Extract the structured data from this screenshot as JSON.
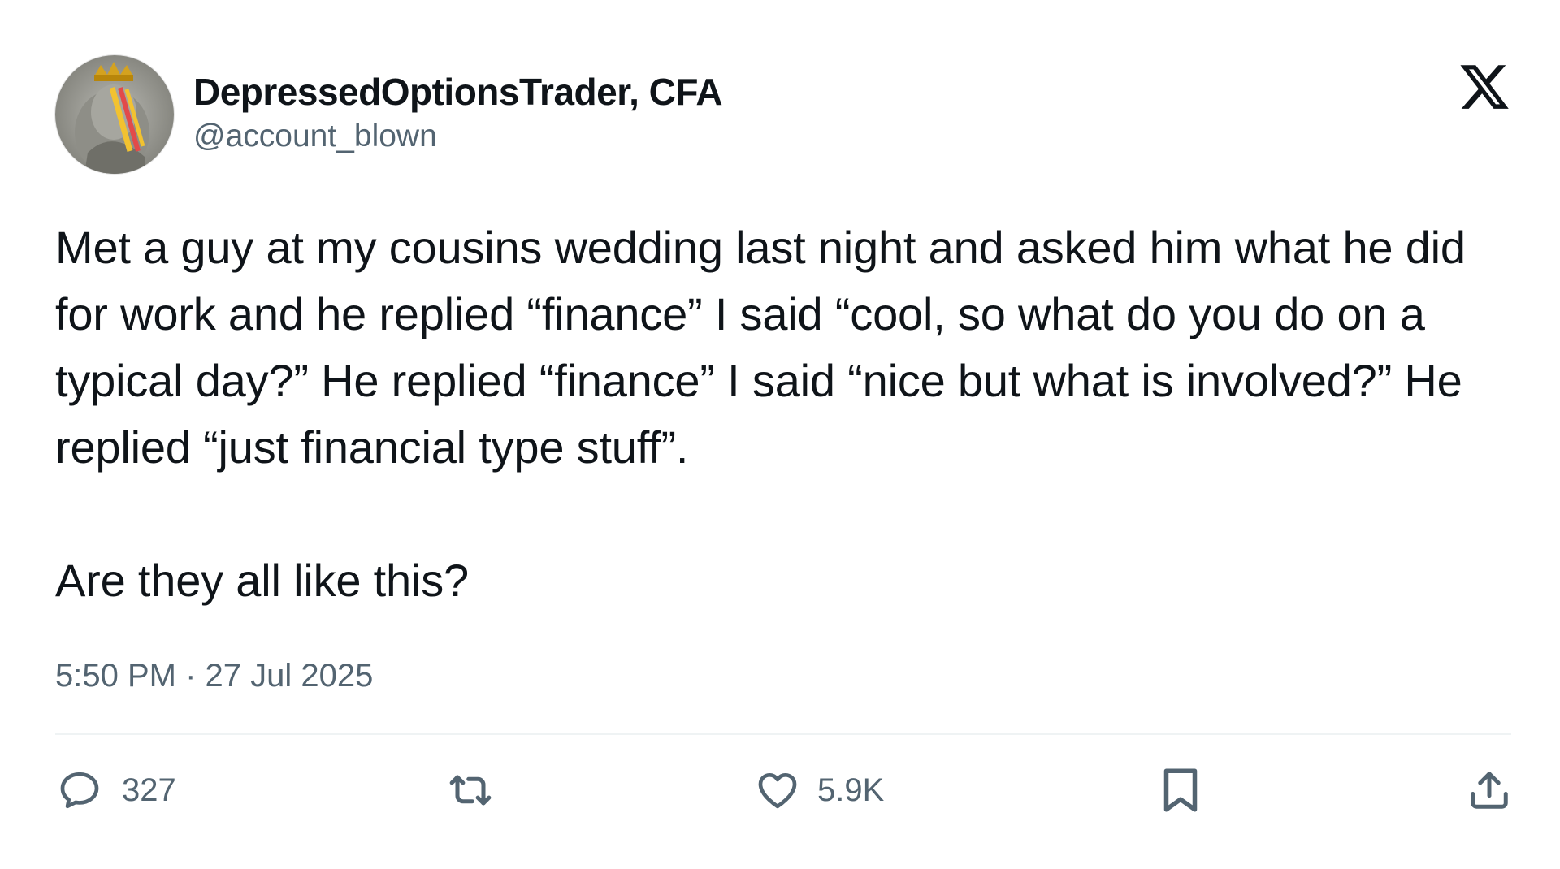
{
  "author": {
    "display_name": "DepressedOptionsTrader, CFA",
    "handle": "@account_blown",
    "avatar_icon": "avatar-photo"
  },
  "brand": {
    "logo_icon": "x-logo"
  },
  "tweet": {
    "paragraph_1": "Met a guy at my cousins wedding last night and asked him what he did for work and he replied “finance” I said “cool, so what do you do on a typical day?” He replied “finance” I said “nice but what is involved?” He replied “just financial type stuff”.",
    "paragraph_2": "Are they all like this?",
    "timestamp": "5:50 PM · 27 Jul 2025"
  },
  "actions": {
    "reply": {
      "icon": "reply-icon",
      "count": "327"
    },
    "repost": {
      "icon": "repost-icon",
      "count": ""
    },
    "like": {
      "icon": "heart-icon",
      "count": "5.9K"
    },
    "bookmark": {
      "icon": "bookmark-icon"
    },
    "share": {
      "icon": "share-icon"
    }
  },
  "colors": {
    "text_primary": "#0f1419",
    "text_secondary": "#536471",
    "divider": "#eff3f4",
    "background": "#ffffff"
  }
}
